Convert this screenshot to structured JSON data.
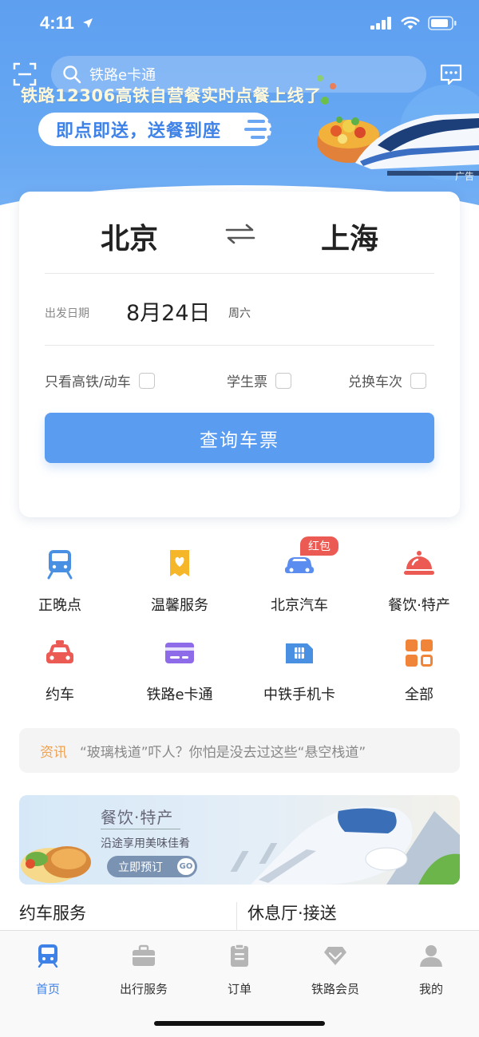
{
  "status_bar": {
    "time": "4:11"
  },
  "search": {
    "placeholder": "铁路e卡通"
  },
  "banner": {
    "title": "铁路12306高铁自营餐实时点餐上线了",
    "pill": "即点即送，送餐到座",
    "ad_tag": "广告"
  },
  "ticket": {
    "from_city": "北京",
    "to_city": "上海",
    "date_label": "出发日期",
    "date_value": "8月24日",
    "weekday": "周六",
    "options": [
      {
        "label": "只看高铁/动车",
        "checked": false
      },
      {
        "label": "学生票",
        "checked": false
      },
      {
        "label": "兑换车次",
        "checked": false
      }
    ],
    "query_button": "查询车票"
  },
  "services": [
    {
      "label": "正晚点",
      "icon": "train-icon",
      "color": "#4a90e2"
    },
    {
      "label": "温馨服务",
      "icon": "heart-ticket-icon",
      "color": "#f5b62a"
    },
    {
      "label": "北京汽车",
      "icon": "car-icon",
      "color": "#5b8df0",
      "badge": "红包"
    },
    {
      "label": "餐饮·特产",
      "icon": "dish-cover-icon",
      "color": "#ec5b53"
    },
    {
      "label": "约车",
      "icon": "taxi-icon",
      "color": "#ec5b53"
    },
    {
      "label": "铁路e卡通",
      "icon": "card-icon",
      "color": "#8e6be8"
    },
    {
      "label": "中铁手机卡",
      "icon": "sim-card-icon",
      "color": "#4a90e2"
    },
    {
      "label": "全部",
      "icon": "grid-icon",
      "color": "#f0853a"
    }
  ],
  "news": {
    "tag": "资讯",
    "text": "“玻璃栈道”吓人？你怕是没去过这些“悬空栈道”"
  },
  "food_banner": {
    "title": "餐饮·特产",
    "subtitle": "沿途享用美味佳肴",
    "button": "立即预订",
    "go": "GO"
  },
  "sections": {
    "left": "约车服务",
    "right": "休息厅·接送"
  },
  "tabs": [
    {
      "label": "首页",
      "icon": "train-front-icon",
      "active": true
    },
    {
      "label": "出行服务",
      "icon": "briefcase-icon",
      "active": false
    },
    {
      "label": "订单",
      "icon": "clipboard-icon",
      "active": false
    },
    {
      "label": "铁路会员",
      "icon": "diamond-icon",
      "active": false
    },
    {
      "label": "我的",
      "icon": "person-icon",
      "active": false
    }
  ],
  "colors": {
    "primary": "#5a9cf0",
    "accent_orange": "#f0a14f",
    "badge_red": "#ec5b53"
  }
}
